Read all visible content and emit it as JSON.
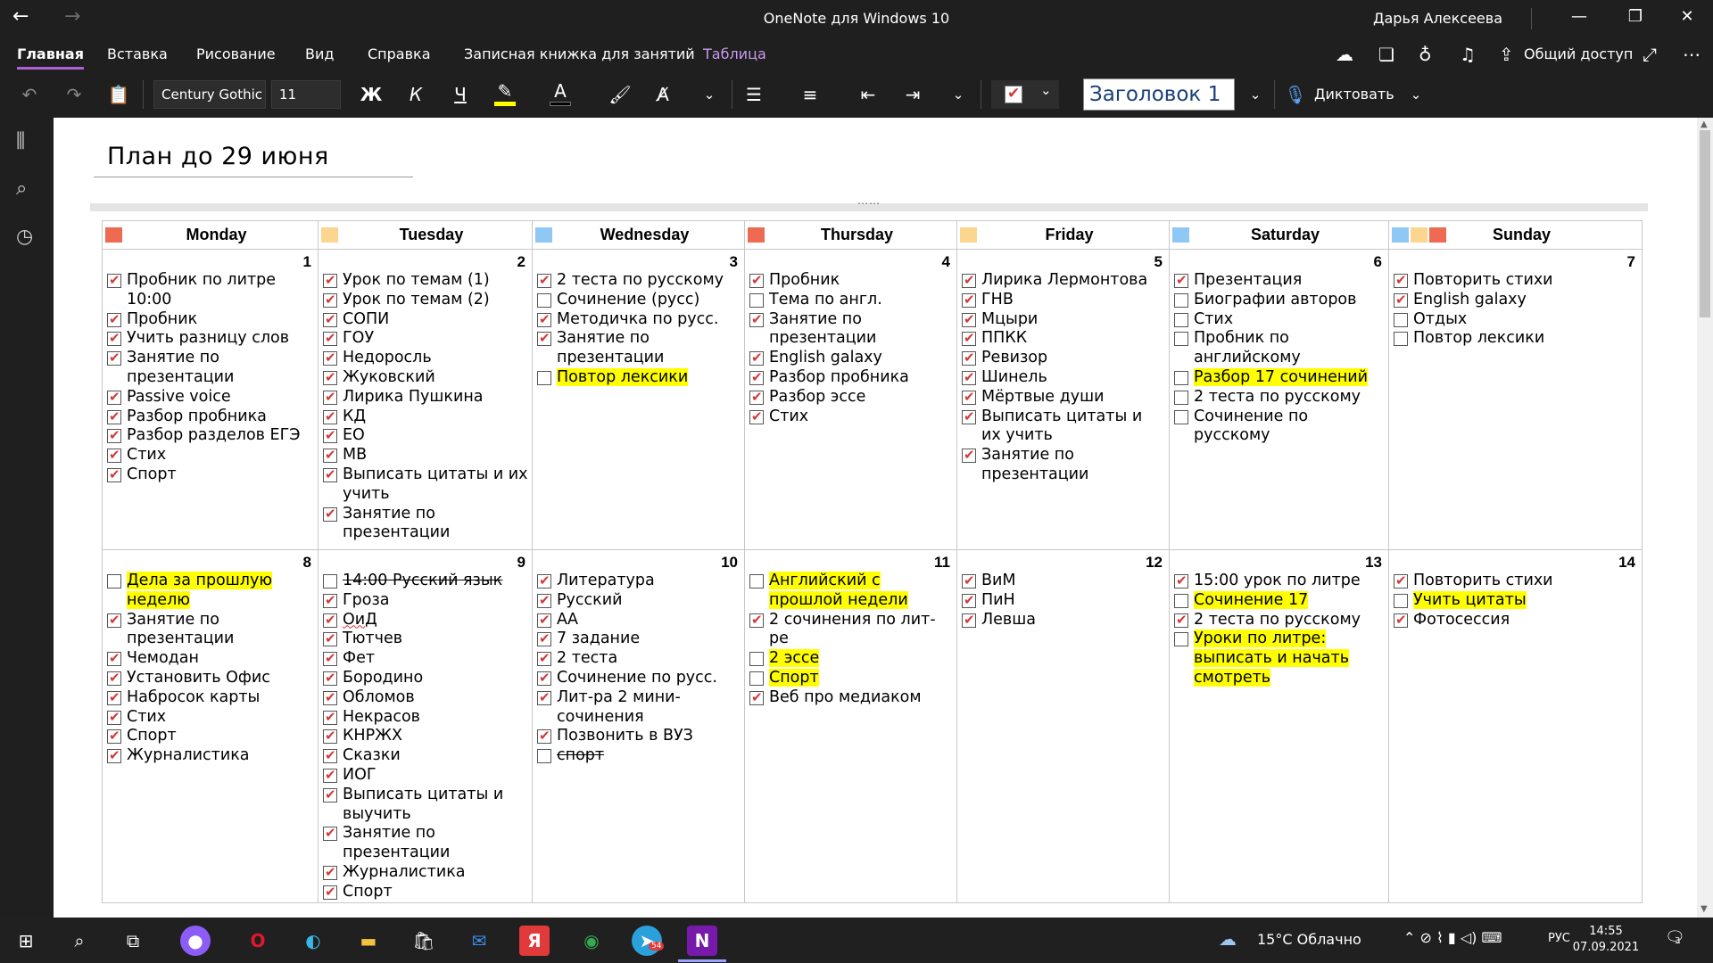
{
  "window": {
    "title": "OneNote для Windows 10",
    "user": "Дарья Алексеева"
  },
  "ribbon": {
    "tabs": [
      "Главная",
      "Вставка",
      "Рисование",
      "Вид",
      "Справка",
      "Записная книжка для занятий",
      "Таблица"
    ],
    "share_label": "Общий доступ"
  },
  "toolbar": {
    "font_name": "Century Gothic",
    "font_size": "11",
    "bold_label": "Ж",
    "italic_label": "К",
    "underline_label": "Ч",
    "font_color_label": "A",
    "style_name": "Заголовок 1",
    "dictate_label": "Диктовать"
  },
  "page": {
    "title": "План до 29 июня"
  },
  "calendar": {
    "days": [
      {
        "name": "Monday",
        "colors": [
          "#ee6a52"
        ]
      },
      {
        "name": "Tuesday",
        "colors": [
          "#fcd58f"
        ]
      },
      {
        "name": "Wednesday",
        "colors": [
          "#8fc7f5"
        ]
      },
      {
        "name": "Thursday",
        "colors": [
          "#ee6a52"
        ]
      },
      {
        "name": "Friday",
        "colors": [
          "#fcd58f"
        ]
      },
      {
        "name": "Saturday",
        "colors": [
          "#8fc7f5"
        ]
      },
      {
        "name": "Sunday",
        "colors": [
          "#8fc7f5",
          "#fcd58f",
          "#ee6a52"
        ]
      }
    ],
    "weeks": [
      [
        {
          "num": "1",
          "tasks": [
            {
              "text": "Пробник по литре 10:00",
              "done": true
            },
            {
              "text": "Пробник",
              "done": true
            },
            {
              "text": "Учить разницу слов",
              "done": true
            },
            {
              "text": "Занятие по презентации",
              "done": true
            },
            {
              "text": "Passive voice",
              "done": true
            },
            {
              "text": "Разбор пробника",
              "done": true
            },
            {
              "text": "Разбор разделов ЕГЭ",
              "done": true
            },
            {
              "text": "Стих",
              "done": true
            },
            {
              "text": "Спорт",
              "done": true
            }
          ]
        },
        {
          "num": "2",
          "tasks": [
            {
              "text": "Урок по темам (1)",
              "done": true
            },
            {
              "text": "Урок по темам (2)",
              "done": true
            },
            {
              "text": "СОПИ",
              "done": true
            },
            {
              "text": "ГОУ",
              "done": true
            },
            {
              "text": "Недоросль",
              "done": true
            },
            {
              "text": "Жуковский",
              "done": true
            },
            {
              "text": "Лирика Пушкина",
              "done": true
            },
            {
              "text": "КД",
              "done": true
            },
            {
              "text": "ЕО",
              "done": true
            },
            {
              "text": "МВ",
              "done": true
            },
            {
              "text": "Выписать цитаты и их учить",
              "done": true
            },
            {
              "text": "Занятие по презентации",
              "done": true
            }
          ]
        },
        {
          "num": "3",
          "tasks": [
            {
              "text": "2 теста по русскому",
              "done": true
            },
            {
              "text": "Сочинение (русс)",
              "done": false
            },
            {
              "text": "Методичка по русс.",
              "done": true
            },
            {
              "text": "Занятие по презентации",
              "done": true
            },
            {
              "text": "Повтор лексики",
              "done": false,
              "highlight": true
            }
          ]
        },
        {
          "num": "4",
          "tasks": [
            {
              "text": "Пробник",
              "done": true
            },
            {
              "text": "Тема по англ.",
              "done": false
            },
            {
              "text": "Занятие по презентации",
              "done": true
            },
            {
              "text": "English galaxy",
              "done": true
            },
            {
              "text": "Разбор пробника",
              "done": true
            },
            {
              "text": "Разбор эссе",
              "done": true
            },
            {
              "text": "Стих",
              "done": true
            }
          ]
        },
        {
          "num": "5",
          "tasks": [
            {
              "text": "Лирика Лермонтова",
              "done": true
            },
            {
              "text": "ГНВ",
              "done": true
            },
            {
              "text": "Мцыри",
              "done": true
            },
            {
              "text": "ППКК",
              "done": true
            },
            {
              "text": "Ревизор",
              "done": true
            },
            {
              "text": "Шинель",
              "done": true
            },
            {
              "text": "Мёртвые души",
              "done": true
            },
            {
              "text": "Выписать цитаты и их учить",
              "done": true
            },
            {
              "text": "Занятие по презентации",
              "done": true
            }
          ]
        },
        {
          "num": "6",
          "tasks": [
            {
              "text": "Презентация",
              "done": true
            },
            {
              "text": "Биографии авторов",
              "done": false
            },
            {
              "text": "Стих",
              "done": false
            },
            {
              "text": "Пробник по английскому",
              "done": false
            },
            {
              "text": "Разбор 17 сочинений",
              "done": false,
              "highlight": true
            },
            {
              "text": "2 теста по русскому",
              "done": false
            },
            {
              "text": "Сочинение по русскому",
              "done": false
            }
          ]
        },
        {
          "num": "7",
          "tasks": [
            {
              "text": "Повторить стихи",
              "done": true
            },
            {
              "text": "English galaxy",
              "done": true
            },
            {
              "text": "Отдых",
              "done": false
            },
            {
              "text": "Повтор лексики",
              "done": false
            }
          ]
        }
      ],
      [
        {
          "num": "8",
          "tasks": [
            {
              "text": "Дела за прошлую неделю",
              "done": false,
              "highlight": true
            },
            {
              "text": "Занятие по презентации",
              "done": true
            },
            {
              "text": "Чемодан",
              "done": true
            },
            {
              "text": "Установить Офис",
              "done": true
            },
            {
              "text": "Набросок карты",
              "done": true
            },
            {
              "text": "Стих",
              "done": true
            },
            {
              "text": "Спорт",
              "done": true
            },
            {
              "text": "Журналистика",
              "done": true
            }
          ]
        },
        {
          "num": "9",
          "tasks": [
            {
              "text": "14:00 Русский язык",
              "done": false,
              "strike": true
            },
            {
              "text": "Гроза",
              "done": true
            },
            {
              "text": "ОиД",
              "done": true,
              "squiggle": true
            },
            {
              "text": "Тютчев",
              "done": true
            },
            {
              "text": "Фет",
              "done": true
            },
            {
              "text": "Бородино",
              "done": true
            },
            {
              "text": "Обломов",
              "done": true
            },
            {
              "text": "Некрасов",
              "done": true
            },
            {
              "text": "КНРЖХ",
              "done": true
            },
            {
              "text": "Сказки",
              "done": true
            },
            {
              "text": "ИОГ",
              "done": true
            },
            {
              "text": "Выписать цитаты и выучить",
              "done": true
            },
            {
              "text": "Занятие по презентации",
              "done": true
            },
            {
              "text": "Журналистика",
              "done": true
            },
            {
              "text": "Спорт",
              "done": true
            }
          ]
        },
        {
          "num": "10",
          "tasks": [
            {
              "text": "Литература",
              "done": true
            },
            {
              "text": "Русский",
              "done": true
            },
            {
              "text": "АА",
              "done": true
            },
            {
              "text": "7 задание",
              "done": true
            },
            {
              "text": "2 теста",
              "done": true
            },
            {
              "text": "Сочинение по русс.",
              "done": true
            },
            {
              "text": "Лит-ра 2 мини-сочинения",
              "done": true
            },
            {
              "text": "Позвонить в ВУЗ",
              "done": true
            },
            {
              "text": "спорт",
              "done": false,
              "strike": true
            }
          ]
        },
        {
          "num": "11",
          "tasks": [
            {
              "text": "Английский с прошлой недели",
              "done": false,
              "highlight": true
            },
            {
              "text": "2 сочинения по лит-ре",
              "done": true
            },
            {
              "text": "2 эссе",
              "done": false,
              "highlight": true
            },
            {
              "text": "Спорт",
              "done": false,
              "highlight": true
            },
            {
              "text": "Веб про медиаком",
              "done": true
            }
          ]
        },
        {
          "num": "12",
          "tasks": [
            {
              "text": "ВиМ",
              "done": true
            },
            {
              "text": "ПиН",
              "done": true
            },
            {
              "text": "Левша",
              "done": true
            }
          ]
        },
        {
          "num": "13",
          "tasks": [
            {
              "text": "15:00 урок по литре",
              "done": true
            },
            {
              "text": "Сочинение 17",
              "done": false,
              "highlight": true
            },
            {
              "text": "2 теста по русскому",
              "done": true
            },
            {
              "text": "Уроки по литре: выписать и начать смотреть",
              "done": false,
              "highlight": true
            }
          ]
        },
        {
          "num": "14",
          "tasks": [
            {
              "text": "Повторить стихи",
              "done": true
            },
            {
              "text": "Учить цитаты",
              "done": false,
              "highlight": true
            },
            {
              "text": "Фотосессия",
              "done": true
            }
          ]
        }
      ]
    ]
  },
  "taskbar": {
    "weather": "15°C Облачно",
    "lang": "РУС",
    "time": "14:55",
    "date": "07.09.2021",
    "notification_count": "3",
    "telegram_badge": "54"
  }
}
